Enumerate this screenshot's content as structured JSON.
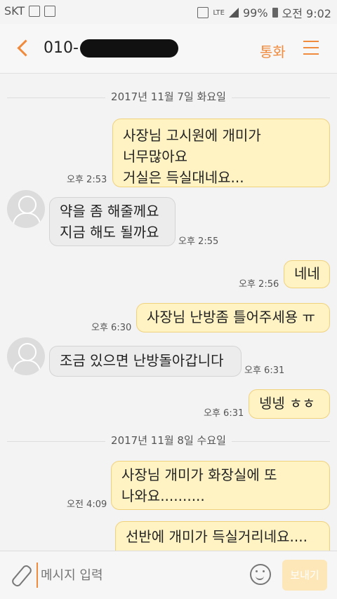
{
  "status": {
    "carrier": "SKT",
    "lte": "LTE",
    "battery": "99%",
    "time": "오전 9:02"
  },
  "header": {
    "title_prefix": "010-",
    "call_label": "통화"
  },
  "dates": [
    "2017년 11월 7일 화요일",
    "2017년 11월 8일 수요일"
  ],
  "messages": [
    {
      "dir": "out",
      "text": "사장님 고시원에 개미가\n너무많아요\n거실은 득실대네요...",
      "time": "오후 2:53"
    },
    {
      "dir": "in",
      "text": "약을 좀 해줄께요\n지금 해도 될까요",
      "time": "오후 2:55"
    },
    {
      "dir": "out",
      "text": "네네",
      "time": "오후 2:56"
    },
    {
      "dir": "out",
      "text": "사장님 난방좀 틀어주세용 ㅠ",
      "time": "오후 6:30"
    },
    {
      "dir": "in",
      "text": "조금 있으면 난방돌아갑니다",
      "time": "오후 6:31"
    },
    {
      "dir": "out",
      "text": "넹넹 ㅎㅎ",
      "time": "오후 6:31"
    },
    {
      "dir": "out",
      "text": "사장님 개미가 화장실에 또\n나와요..........",
      "time": "오전 4:09"
    },
    {
      "dir": "out",
      "text": "선반에 개미가 득실거리네요....",
      "time": ""
    }
  ],
  "input": {
    "placeholder": "메시지 입력",
    "send_label": "보내기"
  },
  "colors": {
    "accent": "#f08a3c",
    "outgoing": "#fff3c4",
    "incoming": "#ececec"
  }
}
